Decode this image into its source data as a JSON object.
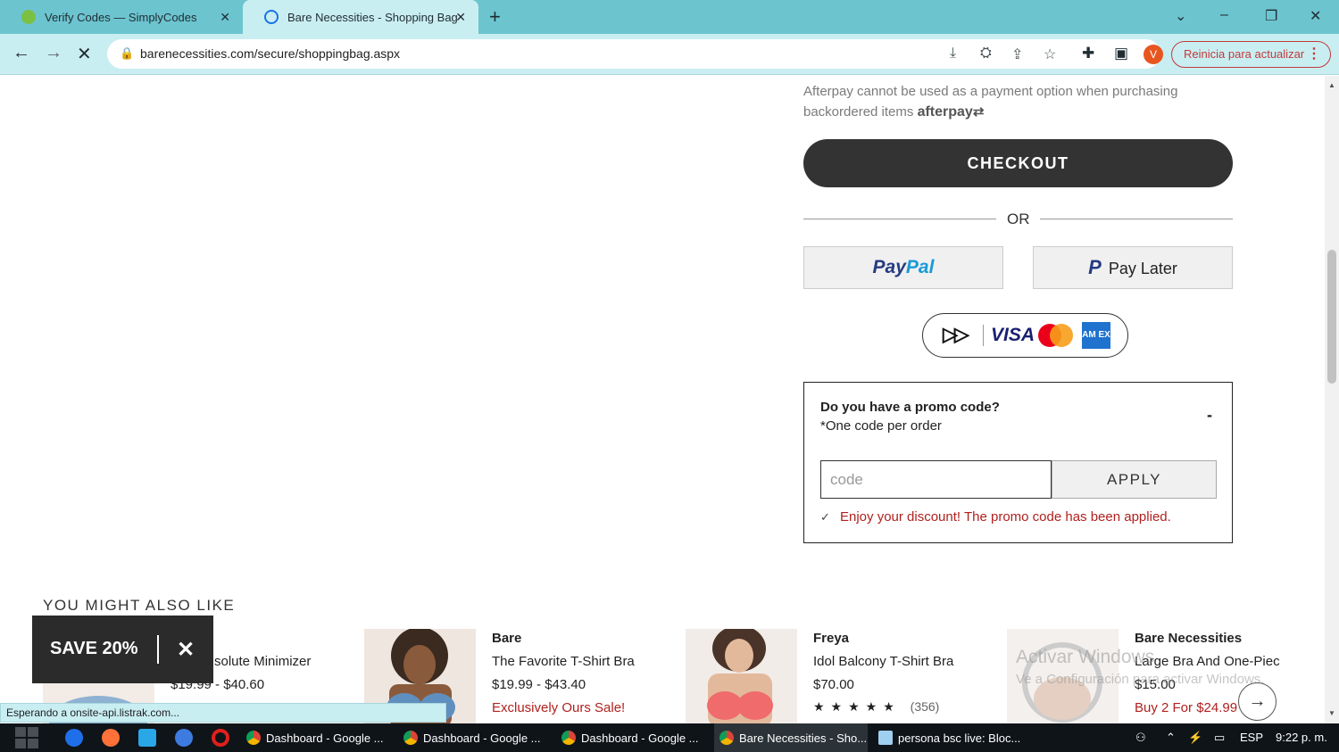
{
  "browser": {
    "tabs": [
      {
        "title": "Verify Codes — SimplyCodes",
        "active": false
      },
      {
        "title": "Bare Necessities - Shopping Bag",
        "active": true
      }
    ],
    "new_tab_symbol": "+",
    "url": "barenecessities.com/secure/shoppingbag.aspx",
    "profile_initial": "V",
    "restart_label": "Reinicia para actualizar",
    "status_text": "Esperando a onsite-api.listrak.com..."
  },
  "cart": {
    "afterpay_note": "Afterpay cannot be used as a payment option when purchasing backordered items",
    "afterpay_logo": "afterpay",
    "checkout_label": "CHECKOUT",
    "or_label": "OR",
    "paypal_pre": "Pay",
    "paypal_post": "Pal",
    "paylater_label": "Pay Later",
    "card_visa": "VISA",
    "card_amex": "AM EX"
  },
  "promo": {
    "question": "Do you have a promo code?",
    "subtext": "*One code per order",
    "toggle": "-",
    "input_placeholder": "code",
    "apply_label": "APPLY",
    "success_message": "Enjoy your discount! The promo code has been applied."
  },
  "recommendations": {
    "title": "YOU MIGHT ALSO LIKE",
    "products": [
      {
        "brand": "",
        "name": "solute Minimizer",
        "price": "$19.99 - $40.60",
        "promo": ""
      },
      {
        "brand": "Bare",
        "name": "The Favorite T-Shirt Bra",
        "price": "$19.99 - $43.40",
        "promo": "Exclusively Ours Sale!"
      },
      {
        "brand": "Freya",
        "name": "Idol Balcony T-Shirt Bra",
        "price": "$70.00",
        "stars": "★★★★★",
        "reviews": "(356)"
      },
      {
        "brand": "Bare Necessities",
        "name": "Large Bra And One-Piec",
        "price": "$15.00",
        "promo": "Buy 2 For $24.99"
      }
    ]
  },
  "popup": {
    "save_label": "SAVE 20%",
    "close_symbol": "✕"
  },
  "watermark": {
    "line1": "Activar Windows",
    "line2": "Ve a Configuración para activar Windows."
  },
  "taskbar": {
    "apps": [
      {
        "label": "Dashboard - Google ..."
      },
      {
        "label": "Dashboard - Google ..."
      },
      {
        "label": "Dashboard - Google ..."
      },
      {
        "label": "Bare Necessities - Sho..."
      },
      {
        "label": "persona bsc live: Bloc..."
      }
    ],
    "language": "ESP",
    "time": "9:22 p. m."
  }
}
